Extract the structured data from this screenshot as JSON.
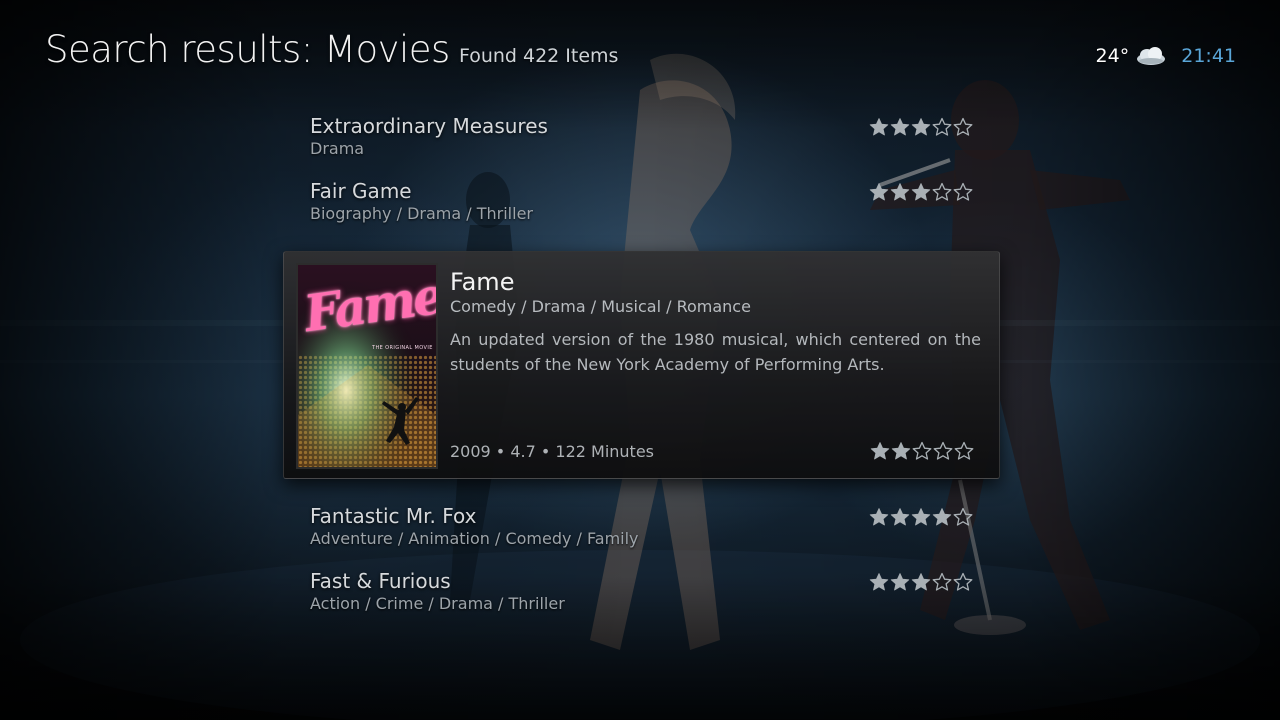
{
  "header": {
    "title": "Search results: Movies",
    "count_label": "Found 422 Items"
  },
  "status": {
    "temperature": "24°",
    "weather_icon": "cloud-icon",
    "clock": "21:41"
  },
  "colors": {
    "clock": "#5aa6d8",
    "star_filled": "#a9b0b5",
    "star_empty": "#a9b0b5",
    "poster_title": "#ff6fb1"
  },
  "movies": [
    {
      "title": "Extraordinary Measures",
      "genre": "Drama",
      "stars": 3
    },
    {
      "title": "Fair Game",
      "genre": "Biography / Drama / Thriller",
      "stars": 3
    },
    {
      "title": "Fantastic Mr. Fox",
      "genre": "Adventure / Animation / Comedy / Family",
      "stars": 4
    },
    {
      "title": "Fast & Furious",
      "genre": "Action / Crime / Drama / Thriller",
      "stars": 3
    }
  ],
  "focused": {
    "title": "Fame",
    "genre": "Comedy / Drama / Musical / Romance",
    "plot": "An updated version of the 1980 musical, which centered on the students of the New York Academy of Performing Arts.",
    "meta": "2009 • 4.7 • 122 Minutes",
    "stars": 2,
    "poster": {
      "title_text": "Fame",
      "tagline": "THE ORIGINAL MOVIE"
    }
  }
}
